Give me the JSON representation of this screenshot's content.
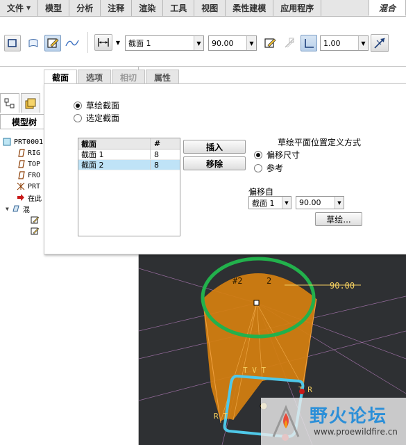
{
  "menubar": {
    "items": [
      "文件",
      "模型",
      "分析",
      "注释",
      "渲染",
      "工具",
      "视图",
      "柔性建模",
      "应用程序"
    ],
    "active_tab": "混合"
  },
  "ribbon": {
    "section_combo": "截面 1",
    "angle_combo": "90.00",
    "scale_combo": "1.00"
  },
  "model_tree": {
    "title": "模型树",
    "rows": [
      {
        "label": "PRT0001",
        "icon": "part-icon"
      },
      {
        "label": "RIG",
        "icon": "datum-plane-icon"
      },
      {
        "label": "TOP",
        "icon": "datum-plane-icon"
      },
      {
        "label": "FRO",
        "icon": "datum-plane-icon"
      },
      {
        "label": "PRT",
        "icon": "coordinate-system-icon"
      },
      {
        "label": "在此",
        "icon": "insert-here-arrow-icon"
      },
      {
        "label": "混",
        "icon": "blend-feature-icon"
      },
      {
        "label": "",
        "icon": "sketch-icon"
      },
      {
        "label": "",
        "icon": "sketch-icon"
      }
    ]
  },
  "panel": {
    "tabs": [
      "截面",
      "选项",
      "相切",
      "属性"
    ],
    "radio_sketched": "草绘截面",
    "radio_selected": "选定截面",
    "table": {
      "headers": [
        "截面",
        "#"
      ],
      "rows": [
        [
          "截面 1",
          "8"
        ],
        [
          "截面 2",
          "8"
        ]
      ]
    },
    "insert_button": "插入",
    "remove_button": "移除",
    "placement_title": "草绘平面位置定义方式",
    "radio_offset": "偏移尺寸",
    "radio_reference": "参考",
    "offset_from_label": "偏移自",
    "offset_section": "截面 1",
    "offset_value": "90.00",
    "sketch_button": "草绘..."
  },
  "viewport": {
    "dim_value": "90.00",
    "section_label_left": "#2",
    "section_label_right": "2"
  },
  "watermark": {
    "text": "野火论坛",
    "url": "www.proewildfire.cn"
  }
}
